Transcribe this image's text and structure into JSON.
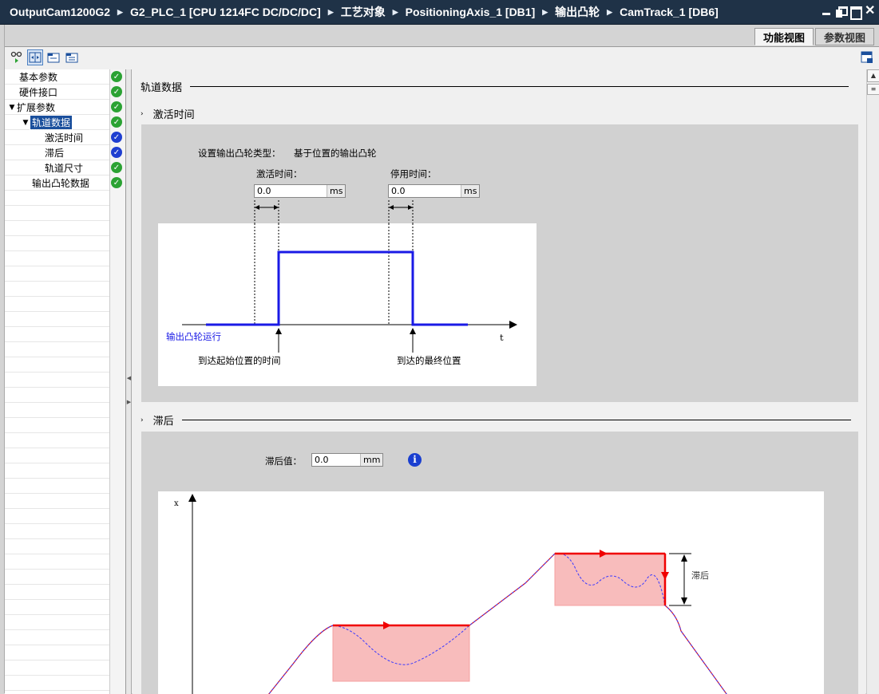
{
  "breadcrumb": [
    "OutputCam1200G2",
    "G2_PLC_1 [CPU 1214FC DC/DC/DC]",
    "工艺对象",
    "PositioningAxis_1 [DB1]",
    "输出凸轮",
    "CamTrack_1 [DB6]"
  ],
  "view_tabs": {
    "function_view": "功能视图",
    "parameter_view": "参数视图"
  },
  "tree": {
    "basic_params": "基本参数",
    "hw_interface": "硬件接口",
    "extended_params": "扩展参数",
    "track_data": "轨道数据",
    "activation_time": "激活时间",
    "hysteresis": "滞后",
    "track_size": "轨道尺寸",
    "output_cam_data": "输出凸轮数据"
  },
  "section_track": "轨道数据",
  "activation": {
    "title": "激活时间",
    "type_label": "设置输出凸轮类型：",
    "type_value": "基于位置的输出凸轮",
    "on_label": "激活时间：",
    "on_value": "0.0",
    "on_unit": "ms",
    "off_label": "停用时间：",
    "off_value": "0.0",
    "off_unit": "ms",
    "diagram": {
      "cam_label": "输出凸轮运行",
      "t_label": "t",
      "start_caption": "到达起始位置的时间",
      "end_caption": "到达的最终位置"
    }
  },
  "hysteresis": {
    "title": "滞后",
    "value_label": "滞后值：",
    "value": "0.0",
    "unit": "mm",
    "diagram": {
      "x_label": "x",
      "hysteresis_label": "滞后"
    }
  },
  "colors": {
    "title_bg": "#1f3247",
    "selection": "#1a4f9c",
    "status_ok": "#2ba233",
    "status_warn": "#1f3fd0",
    "cam_line": "#1a1ae6",
    "hyst_red": "#f00000",
    "hyst_fill": "#f8bcbc"
  }
}
